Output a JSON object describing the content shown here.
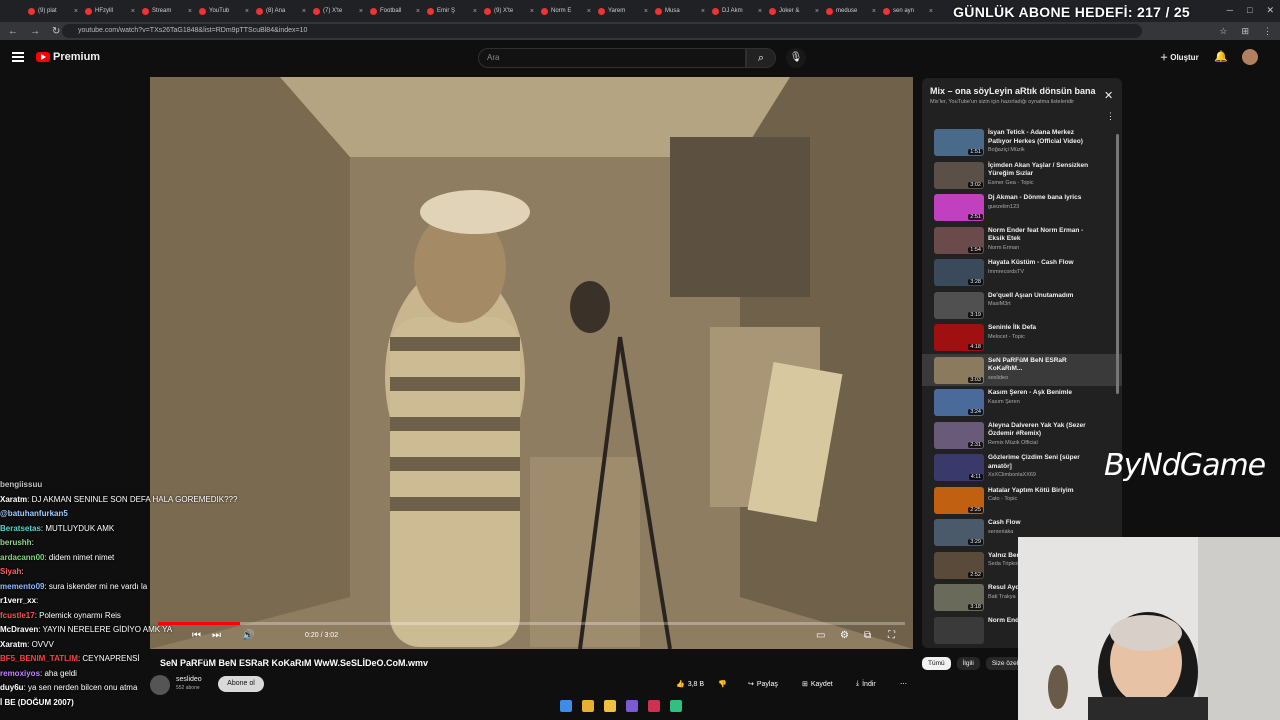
{
  "browser": {
    "tabs": [
      "(9) plat",
      "HFzylll",
      "Stream",
      "YouTub",
      "(8) Ana",
      "(7) X'te",
      "Football",
      "Emir Ş",
      "(9) X'te",
      "Norm E",
      "Yarem",
      "Musa",
      "DJ Akm",
      "Joker &",
      "meduse",
      "sen ayn"
    ],
    "url": "youtube.com/watch?v=TXs26TaG1848&list=RDm9pTTScuBl84&index=10",
    "overlay_goal": "GÜNLÜK ABONE HEDEFİ: 217 / 25"
  },
  "header": {
    "logo_text": "Premium",
    "search_placeholder": "Ara",
    "create_label": "Oluştur"
  },
  "player": {
    "time": "0:20 / 3:02",
    "progress": 0.11
  },
  "video": {
    "title": "SeN PaRFüM BeN ESRaR KoKaRıM WwW.SeSLİDeO.CoM.wmv",
    "channel": "seslideo",
    "subscribers": "552 abone",
    "subscribe_label": "Abone ol",
    "likes": "3,8 B",
    "share_label": "Paylaş",
    "save_label": "Kaydet",
    "download_label": "İndir"
  },
  "mix": {
    "title": "Mix – ona söyLeyin aRtık dönsün bana",
    "subtitle": "Mix'ler, YouTube'un sizin için hazırladığı oynatma listeleridir",
    "items": [
      {
        "title": "İsyan Tetick - Adana Merkez Patlıyor Herkes (Official Video)",
        "artist": "Boğaziçi Müzik",
        "duration": "1:51",
        "color": "#4a6a8a"
      },
      {
        "title": "İçimden Akan Yaşlar / Sensizken Yüreğim Sızlar",
        "artist": "Esmer Gea - Topic",
        "duration": "3:02",
        "color": "#5a5048"
      },
      {
        "title": "Dj Akman - Dönme bana lyrics",
        "artist": "guezelim123",
        "duration": "2:51",
        "color": "#c040c0"
      },
      {
        "title": "Norm Ender feat Norm Erman - Eksik Etek",
        "artist": "Norm Erman",
        "duration": "1:54",
        "color": "#6a4a4a"
      },
      {
        "title": "Hayata Küstüm - Cash Flow",
        "artist": "ImmrecordsTV",
        "duration": "3:28",
        "color": "#3a4a5a"
      },
      {
        "title": "De'quell Aşıan Unutamadım",
        "artist": "MaxiM3rt",
        "duration": "3:19",
        "color": "#505050"
      },
      {
        "title": "Seninle İlk Defa",
        "artist": "Melocet - Topic",
        "duration": "4:18",
        "color": "#a01010"
      },
      {
        "title": "SeN PaRFüM BeN ESRaR KoKaRıM...",
        "artist": "seslideo",
        "duration": "3:03",
        "color": "#8b7a5e",
        "active": true
      },
      {
        "title": "Kasım Şeren - Aşk Benimle",
        "artist": "Kasım Şeren",
        "duration": "3:24",
        "color": "#4a6a9a"
      },
      {
        "title": "Aleyna Dalveren Yak Yak (Sezer Özdemir #Remix)",
        "artist": "Remix Müzik Official",
        "duration": "2:31",
        "color": "#6a5a7a"
      },
      {
        "title": "Gözlerime Çizdim Seni [süper amatör]",
        "artist": "XxXClimbonlaXX69",
        "duration": "4:11",
        "color": "#3a3a6a"
      },
      {
        "title": "Hatalar Yaptım Kötü Biriyim",
        "artist": "Cato - Topic",
        "duration": "2:25",
        "color": "#c06010"
      },
      {
        "title": "Cash Flow",
        "artist": "serseriaka",
        "duration": "3:29",
        "color": "#4a5a6a"
      },
      {
        "title": "Yalnız Ben",
        "artist": "Seda Tripkolu",
        "duration": "2:52",
        "color": "#5a4a3a"
      },
      {
        "title": "Resul Aydemir Çocukluğum",
        "artist": "Bati Trakya",
        "duration": "3:18",
        "color": "#6a6a5a"
      },
      {
        "title": "Norm Ender",
        "artist": "",
        "duration": "",
        "color": "#3a3a3a"
      }
    ]
  },
  "chips": [
    "Tümü",
    "İlgili",
    "Size özel"
  ],
  "chat": [
    {
      "user": "bengiissuu",
      "text": "",
      "color": "#c0c0c0"
    },
    {
      "user": "Xaratm",
      "text": ": DJ AKMAN SENINLE SON DEFA HALA GOREMEDIK???",
      "color": "#ffffff"
    },
    {
      "user": "@batuhanfurkan5",
      "text": "",
      "color": "#9ecbff"
    },
    {
      "user": "Beratsetas",
      "text": ": MUTLUYDUK AMK",
      "color": "#5ad1d1"
    },
    {
      "user": "berushh",
      "text": ":",
      "color": "#8fd18f"
    },
    {
      "user": "ardacann00",
      "text": ": didem nimet nimet",
      "color": "#7cd67c"
    },
    {
      "user": "Siyah",
      "text": ":",
      "color": "#ff6060"
    },
    {
      "user": "memento09",
      "text": ": sura iskender mi ne vardı la",
      "color": "#8fb8ff"
    },
    {
      "user": "r1verr_xx",
      "text": ":",
      "color": "#ffffff"
    },
    {
      "user": "fcustle17",
      "text": ": Polemick oynarmı Reis",
      "color": "#ff5050"
    },
    {
      "user": "McDraven",
      "text": ": YAYIN NERELERE GİDİYO AMK YA",
      "color": "#ffffff"
    },
    {
      "user": "Xaratm",
      "text": ": OVVV",
      "color": "#ffffff"
    },
    {
      "user": "BF5_BENIM_TATLIM",
      "text": ": CEYNAPRENSİ",
      "color": "#ff4040"
    },
    {
      "user": "remoxiyos",
      "text": ": aha geldi",
      "color": "#c080ff"
    },
    {
      "user": "duy6u",
      "text": ": ya sen nerden bilcen onu atma",
      "color": "#ffffff"
    },
    {
      "user": "İ BE (DOĞUM 2007)",
      "text": "",
      "color": "#ffffff"
    }
  ],
  "watermark": "ByNdGame"
}
